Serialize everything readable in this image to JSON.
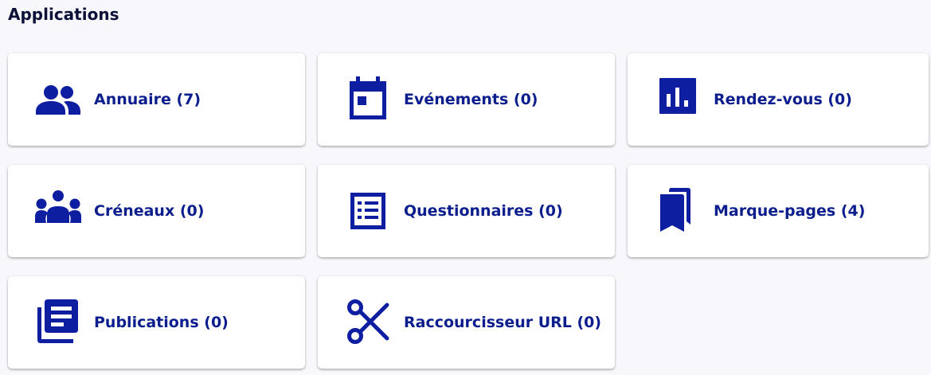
{
  "page": {
    "title": "Applications"
  },
  "colors": {
    "background": "#f8f8fc",
    "card": "#ffffff",
    "accent": "#0e1ea0",
    "title_text": "#0c1138"
  },
  "apps": [
    {
      "label": "Annuaire (7)",
      "icon": "people-icon"
    },
    {
      "label": "Evénements (0)",
      "icon": "calendar-icon"
    },
    {
      "label": "Rendez-vous (0)",
      "icon": "bar-chart-icon"
    },
    {
      "label": "Créneaux (0)",
      "icon": "group-icon"
    },
    {
      "label": "Questionnaires (0)",
      "icon": "list-icon"
    },
    {
      "label": "Marque-pages (4)",
      "icon": "bookmarks-icon"
    },
    {
      "label": "Publications (0)",
      "icon": "library-books-icon"
    },
    {
      "label": "Raccourcisseur URL (0)",
      "icon": "scissors-icon"
    }
  ]
}
